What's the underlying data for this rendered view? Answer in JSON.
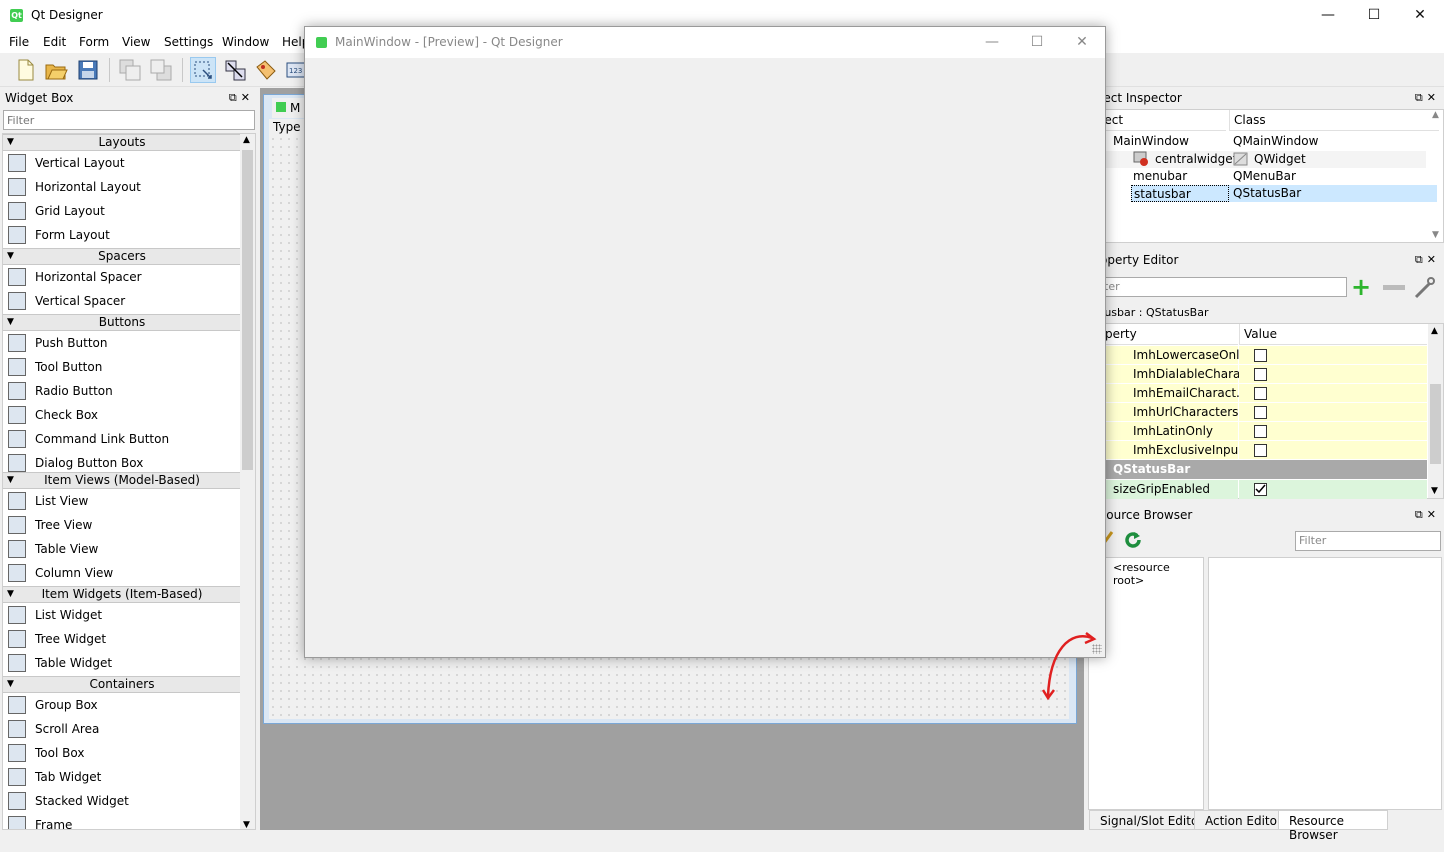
{
  "app": {
    "title": "Qt Designer",
    "icon": "Qt"
  },
  "window_controls": {
    "minimize": "—",
    "maximize": "☐",
    "close": "✕"
  },
  "menu": [
    "File",
    "Edit",
    "Form",
    "View",
    "Settings",
    "Window",
    "Help"
  ],
  "toolbar": {
    "icons": [
      "new-file-icon",
      "open-folder-icon",
      "save-icon",
      "send-to-back-icon",
      "bring-to-front-icon",
      "edit-widgets-icon",
      "edit-signals-slots-icon",
      "edit-buddies-icon",
      "edit-tab-order-icon"
    ]
  },
  "widget_box": {
    "title": "Widget Box",
    "filter_placeholder": "Filter",
    "categories": [
      {
        "name": "Layouts",
        "items": [
          "Vertical Layout",
          "Horizontal Layout",
          "Grid Layout",
          "Form Layout"
        ]
      },
      {
        "name": "Spacers",
        "items": [
          "Horizontal Spacer",
          "Vertical Spacer"
        ]
      },
      {
        "name": "Buttons",
        "items": [
          "Push Button",
          "Tool Button",
          "Radio Button",
          "Check Box",
          "Command Link Button",
          "Dialog Button Box"
        ]
      },
      {
        "name": "Item Views (Model-Based)",
        "items": [
          "List View",
          "Tree View",
          "Table View",
          "Column View"
        ]
      },
      {
        "name": "Item Widgets (Item-Based)",
        "items": [
          "List Widget",
          "Tree Widget",
          "Table Widget"
        ]
      },
      {
        "name": "Containers",
        "items": [
          "Group Box",
          "Scroll Area",
          "Tool Box",
          "Tab Widget",
          "Stacked Widget",
          "Frame"
        ]
      }
    ]
  },
  "form": {
    "tab_label": "M",
    "menu_placeholder": "Type"
  },
  "preview": {
    "title": "MainWindow - [Preview] - Qt Designer"
  },
  "object_inspector": {
    "title": "ject Inspector",
    "col_object": "ject",
    "col_class": "Class",
    "rows": [
      {
        "object": "MainWindow",
        "class": "QMainWindow"
      },
      {
        "object": "centralwidget",
        "class": "QWidget"
      },
      {
        "object": "menubar",
        "class": "QMenuBar"
      },
      {
        "object": "statusbar",
        "class": "QStatusBar"
      }
    ]
  },
  "property_editor": {
    "title": "operty Editor",
    "filter_placeholder": "ter",
    "context": "tusbar : QStatusBar",
    "col_property": "perty",
    "col_value": "Value",
    "rows": [
      {
        "name": "ImhLowercaseOnly",
        "checked": false
      },
      {
        "name": "ImhDialableChara...",
        "checked": false
      },
      {
        "name": "ImhEmailCharact...",
        "checked": false
      },
      {
        "name": "ImhUrlCharacters...",
        "checked": false
      },
      {
        "name": "ImhLatinOnly",
        "checked": false
      },
      {
        "name": "ImhExclusiveInpu...",
        "checked": false
      }
    ],
    "section": "QStatusBar",
    "size_grip": {
      "name": "sizeGripEnabled",
      "checked": true
    }
  },
  "resource_browser": {
    "title": "source Browser",
    "filter_placeholder": "Filter",
    "root": "<resource root>"
  },
  "bottom_tabs": [
    "Signal/Slot Editor",
    "Action Editor",
    "Resource Browser"
  ],
  "colors": {
    "accent": "#41cd52",
    "selection": "#cce8ff",
    "prop_yellow": "#ffffd0",
    "prop_green": "#dcf5dc"
  }
}
